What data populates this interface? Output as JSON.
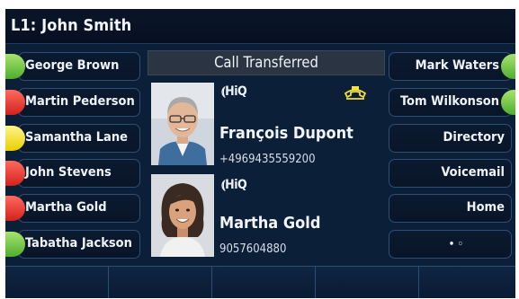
{
  "title": "L1: John Smith",
  "left_keys": [
    {
      "label": "George Brown",
      "led": "green"
    },
    {
      "label": "Martin Pederson",
      "led": "red"
    },
    {
      "label": "Samantha Lane",
      "led": "yellow"
    },
    {
      "label": "John Stevens",
      "led": "red"
    },
    {
      "label": "Martha Gold",
      "led": "red"
    },
    {
      "label": "Tabatha Jackson",
      "led": "green"
    }
  ],
  "right_keys": [
    {
      "label": "Mark Waters",
      "led": "green"
    },
    {
      "label": "Tom Wilkonson",
      "led": "green"
    },
    {
      "label": "Directory",
      "led": "none"
    },
    {
      "label": "Voicemail",
      "led": "none"
    },
    {
      "label": "Home",
      "led": "none"
    },
    {
      "label": "• ◦",
      "led": "none"
    }
  ],
  "call": {
    "status": "Call Transferred",
    "logo_text": "⦅HiQ",
    "party1": {
      "name": "François Dupont",
      "number": "+4969435559200"
    },
    "party2": {
      "name": "Martha Gold",
      "number": "9057604880"
    }
  },
  "colors": {
    "background": "#0b1f38",
    "led_green": "#6fcf3c",
    "led_red": "#e53224",
    "led_yellow": "#f3e03a"
  },
  "icons": [
    "hiq-logo-icon",
    "phone-handset-icon"
  ]
}
